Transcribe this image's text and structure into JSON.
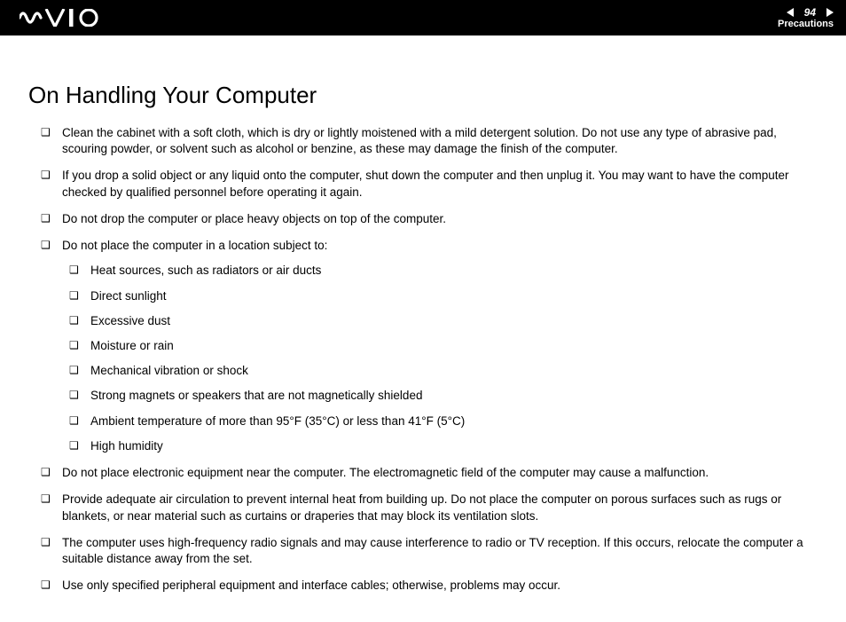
{
  "header": {
    "page_number": "94",
    "section": "Precautions"
  },
  "title": "On Handling Your Computer",
  "bullets": [
    {
      "text": "Clean the cabinet with a soft cloth, which is dry or lightly moistened with a mild detergent solution. Do not use any type of abrasive pad, scouring powder, or solvent such as alcohol or benzine, as these may damage the finish of the computer."
    },
    {
      "text": "If you drop a solid object or any liquid onto the computer, shut down the computer and then unplug it. You may want to have the computer checked by qualified personnel before operating it again."
    },
    {
      "text": "Do not drop the computer or place heavy objects on top of the computer."
    },
    {
      "text": "Do not place the computer in a location subject to:",
      "sub": [
        "Heat sources, such as radiators or air ducts",
        "Direct sunlight",
        "Excessive dust",
        "Moisture or rain",
        "Mechanical vibration or shock",
        "Strong magnets or speakers that are not magnetically shielded",
        "Ambient temperature of more than 95°F (35°C) or less than 41°F (5°C)",
        "High humidity"
      ]
    },
    {
      "text": "Do not place electronic equipment near the computer. The electromagnetic field of the computer may cause a malfunction."
    },
    {
      "text": "Provide adequate air circulation to prevent internal heat from building up. Do not place the computer on porous surfaces such as rugs or blankets, or near material such as curtains or draperies that may block its ventilation slots."
    },
    {
      "text": "The computer uses high-frequency radio signals and may cause interference to radio or TV reception. If this occurs, relocate the computer a suitable distance away from the set."
    },
    {
      "text": "Use only specified peripheral equipment and interface cables; otherwise, problems may occur."
    }
  ]
}
